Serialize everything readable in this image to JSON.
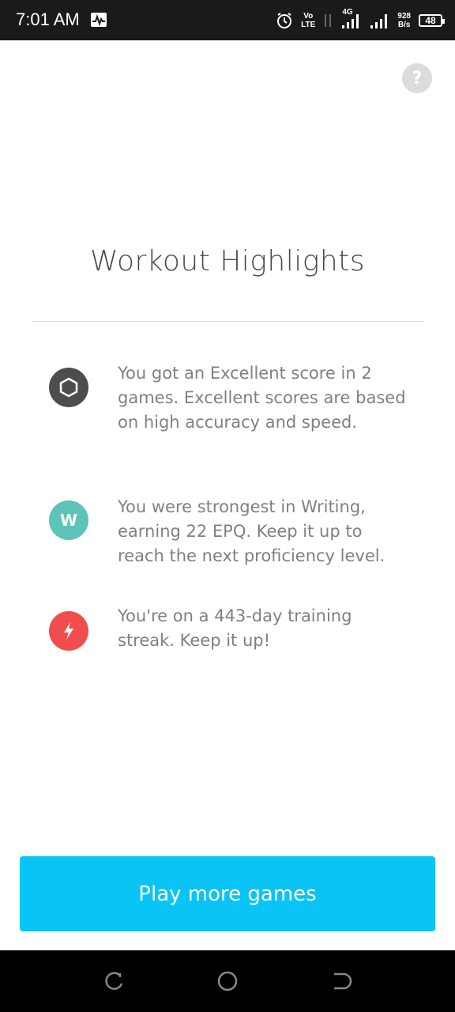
{
  "status_bar": {
    "time": "7:01 AM",
    "network_top": "Vo",
    "network_bottom": "LTE",
    "data_type": "4G",
    "speed_value": "928",
    "speed_unit": "B/s",
    "battery": "48"
  },
  "help": {
    "label": "?"
  },
  "page": {
    "title": "Workout Highlights"
  },
  "highlights": [
    {
      "icon": "hexagon-icon",
      "color": "#4d4d4d",
      "text": "You got an Excellent score in 2 games. Excellent scores are based on high accuracy and speed."
    },
    {
      "icon": "writing-w-icon",
      "icon_letter": "W",
      "color": "#5cc4b8",
      "text": "You were strongest in Writing, earning 22 EPQ. Keep it up to reach the next proficiency level."
    },
    {
      "icon": "lightning-icon",
      "color": "#f04e4e",
      "text": "You're on a 443-day training streak. Keep it up!"
    }
  ],
  "cta": {
    "label": "Play more games",
    "color": "#0ac4f5"
  }
}
